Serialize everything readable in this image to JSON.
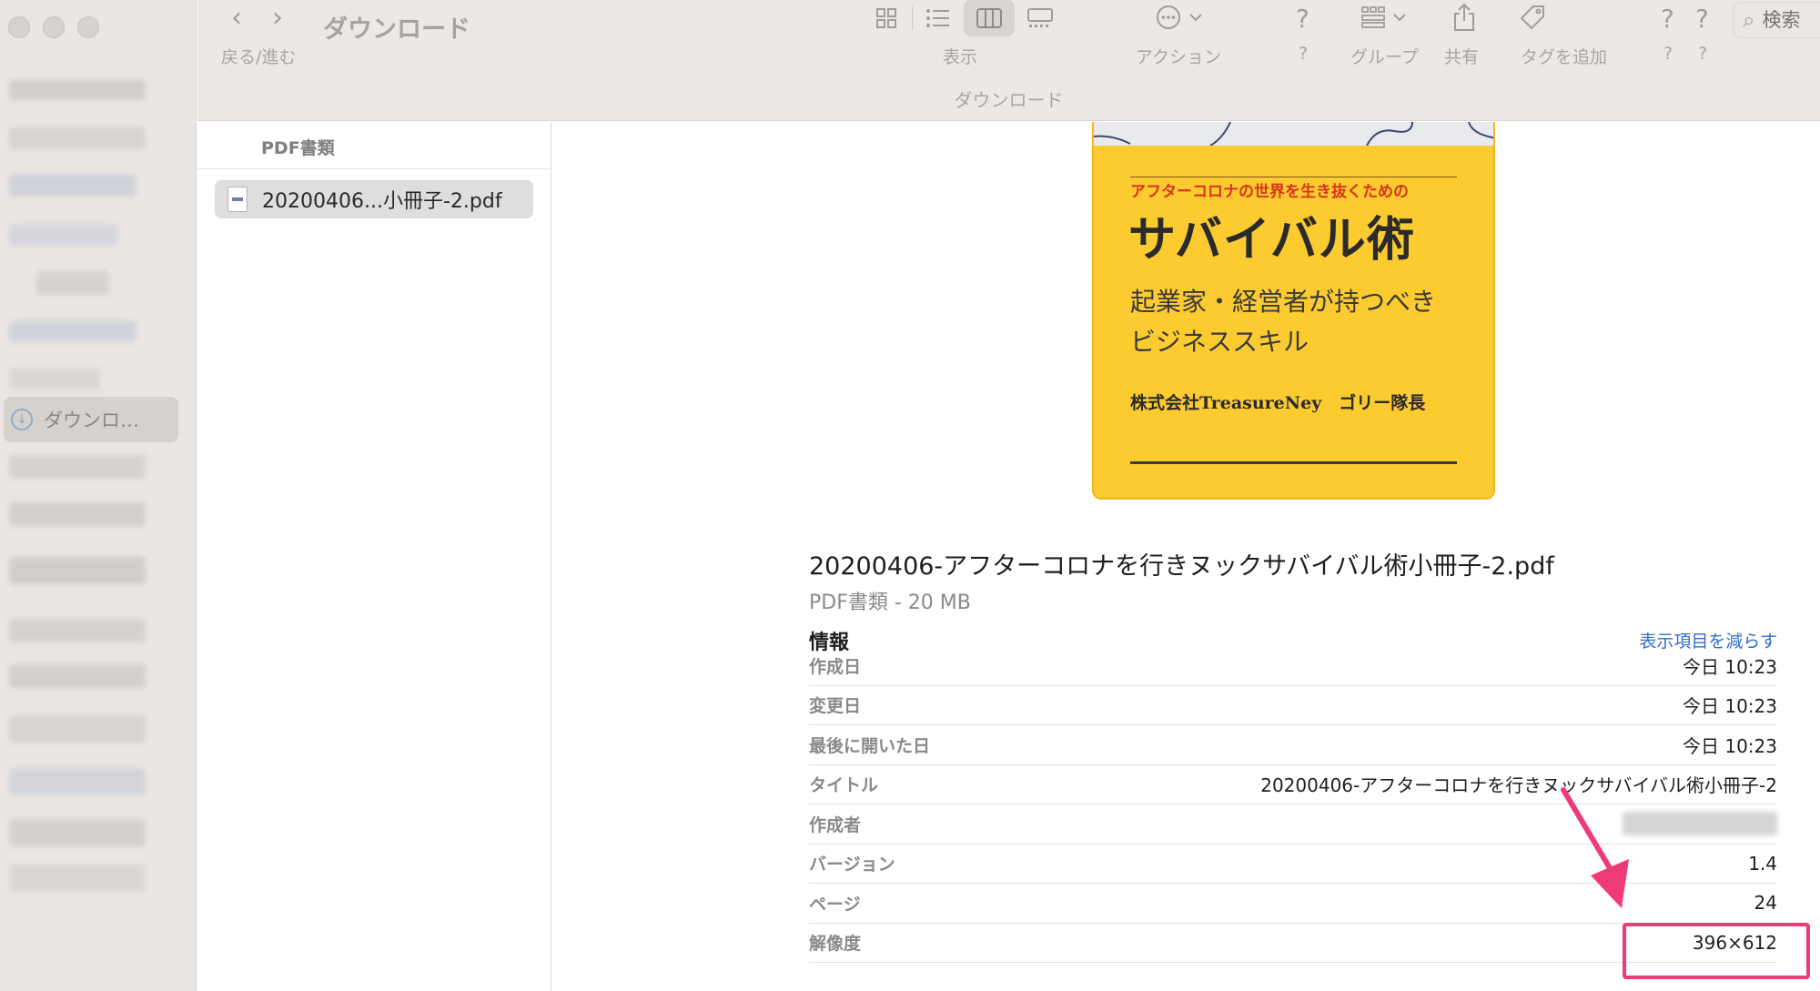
{
  "window": {
    "nav_label": "戻る/進む",
    "title": "ダウンロード",
    "path_title": "ダウンロード"
  },
  "toolbar": {
    "view_label": "表示",
    "action_label": "アクション",
    "unknown1_glyph": "?",
    "unknown1_label": "?",
    "group_label": "グループ",
    "share_label": "共有",
    "tag_label": "タグを追加",
    "unknown2_glyph": "?",
    "unknown2_label": "?",
    "unknown3_glyph": "?",
    "unknown3_label": "?",
    "search_placeholder": "検索",
    "icons": [
      "back-icon",
      "forward-icon",
      "grid-view-icon",
      "list-view-icon",
      "column-view-icon",
      "gallery-view-icon",
      "action-icon",
      "group-icon",
      "share-icon",
      "tag-icon",
      "search-icon"
    ]
  },
  "sidebar": {
    "selected_label": "ダウンロ…"
  },
  "column": {
    "header": "PDF書類",
    "file_name": "20200406...小冊子-2.pdf"
  },
  "cover": {
    "subtitle": "アフターコロナの世界を生き抜くための",
    "title": "サバイバル術",
    "line1": "起業家・経営者が持つべき",
    "line2": "ビジネススキル",
    "author": "株式会社TreasureNey　ゴリー隊長"
  },
  "preview": {
    "file_name": "20200406-アフターコロナを行きヌックサバイバル術小冊子-2.pdf",
    "kind_size": "PDF書類 - 20 MB",
    "info_heading": "情報",
    "show_less": "表示項目を減らす",
    "rows": [
      {
        "key": "作成日",
        "value": "今日 10:23"
      },
      {
        "key": "変更日",
        "value": "今日 10:23"
      },
      {
        "key": "最後に開いた日",
        "value": "今日 10:23"
      },
      {
        "key": "タイトル",
        "value": "20200406-アフターコロナを行きヌックサバイバル術小冊子-2"
      },
      {
        "key": "作成者",
        "value": ""
      },
      {
        "key": "バージョン",
        "value": "1.4"
      },
      {
        "key": "ページ",
        "value": "24"
      },
      {
        "key": "解像度",
        "value": "396×612"
      }
    ]
  },
  "colors": {
    "annotation": "#ef3a7a",
    "link": "#2f6fce",
    "cover_bg": "#fccb30",
    "cover_accent": "#d9341c"
  }
}
